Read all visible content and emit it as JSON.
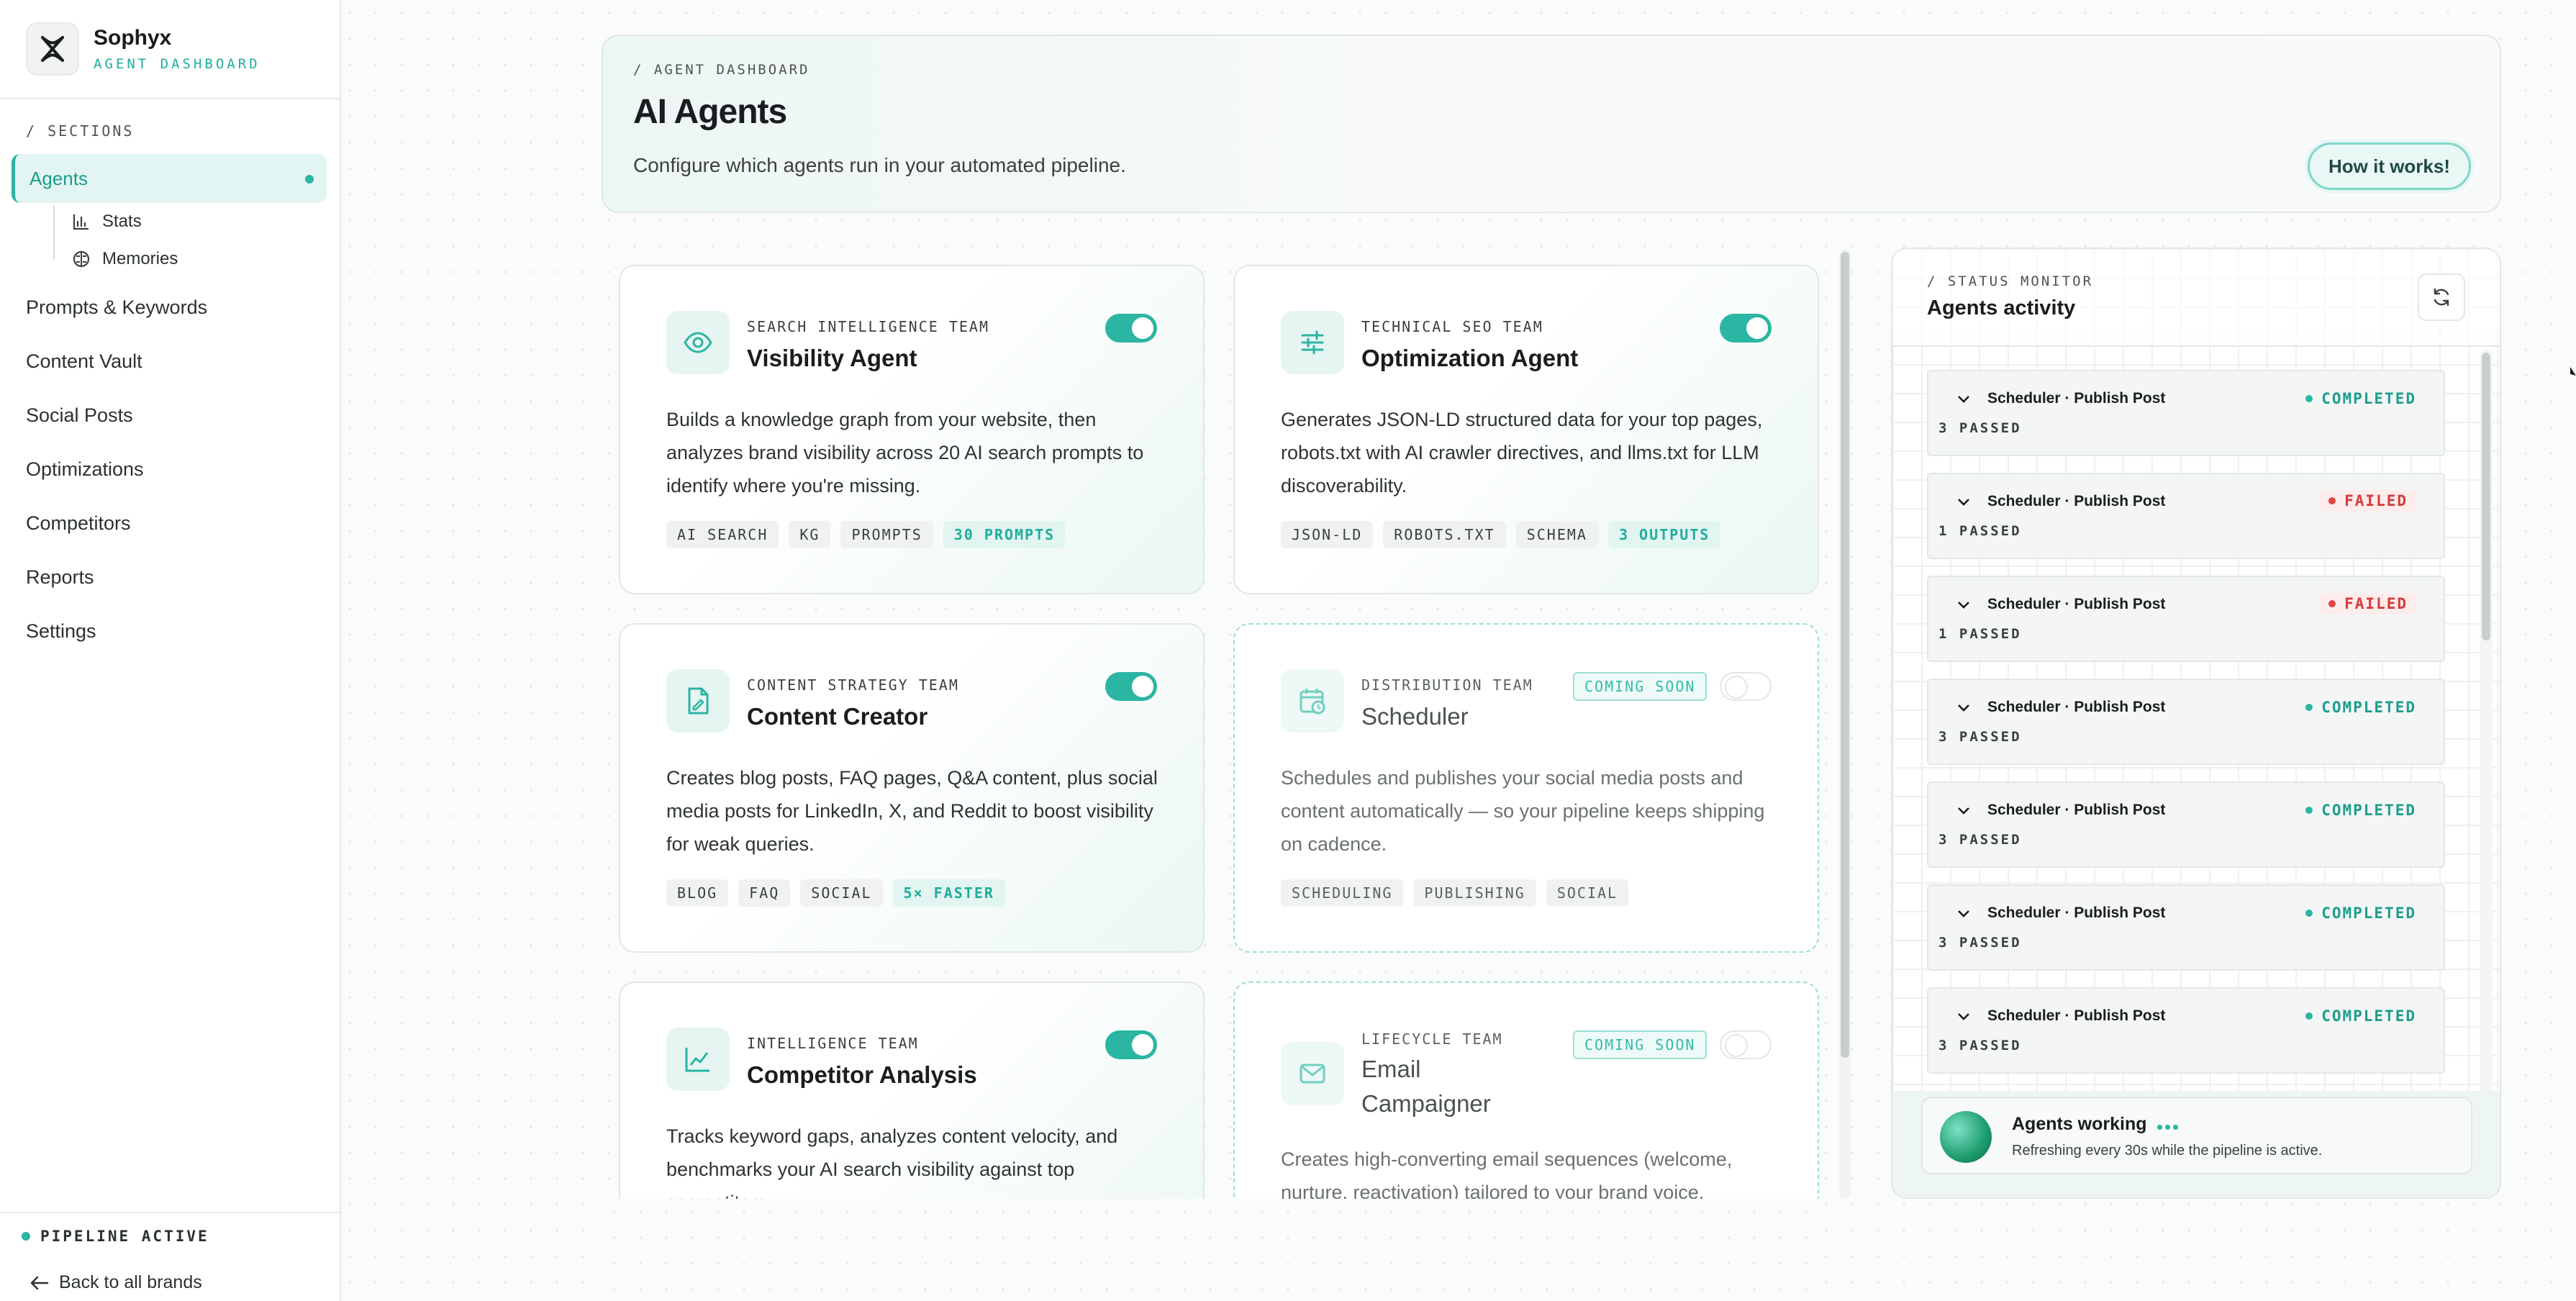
{
  "brand": {
    "name": "Sophyx",
    "subtitle": "AGENT DASHBOARD"
  },
  "sidebar": {
    "section_label": "/ SECTIONS",
    "active_item": "Agents",
    "sub_items": [
      {
        "label": "Stats",
        "icon": "bar-chart-icon"
      },
      {
        "label": "Memories",
        "icon": "brain-icon"
      }
    ],
    "items": [
      "Prompts & Keywords",
      "Content Vault",
      "Social Posts",
      "Optimizations",
      "Competitors",
      "Reports",
      "Settings"
    ],
    "footer_status": "PIPELINE ACTIVE",
    "back_link": "Back to all brands"
  },
  "header": {
    "breadcrumb": "/ AGENT DASHBOARD",
    "title": "AI Agents",
    "description": "Configure which agents run in your automated pipeline.",
    "how_button": "How it works!"
  },
  "agents": [
    {
      "team": "SEARCH INTELLIGENCE TEAM",
      "name": "Visibility Agent",
      "icon": "eye-icon",
      "enabled": true,
      "description": "Builds a knowledge graph from your website, then analyzes brand visibility across 20 AI search prompts to identify where you're missing.",
      "tags": [
        "AI SEARCH",
        "KG",
        "PROMPTS"
      ],
      "accent_tag": "30 PROMPTS"
    },
    {
      "team": "TECHNICAL SEO TEAM",
      "name": "Optimization Agent",
      "icon": "sliders-icon",
      "enabled": true,
      "description": "Generates JSON-LD structured data for your top pages, robots.txt with AI crawler directives, and llms.txt for LLM discoverability.",
      "tags": [
        "JSON-LD",
        "ROBOTS.TXT",
        "SCHEMA"
      ],
      "accent_tag": "3 OUTPUTS"
    },
    {
      "team": "CONTENT STRATEGY TEAM",
      "name": "Content Creator",
      "icon": "document-edit-icon",
      "enabled": true,
      "description": "Creates blog posts, FAQ pages, Q&A content, plus social media posts for LinkedIn, X, and Reddit to boost visibility for weak queries.",
      "tags": [
        "BLOG",
        "FAQ",
        "SOCIAL"
      ],
      "accent_tag": "5× FASTER"
    },
    {
      "team": "DISTRIBUTION TEAM",
      "name": "Scheduler",
      "icon": "calendar-clock-icon",
      "enabled": false,
      "badge": "COMING SOON",
      "description": "Schedules and publishes your social media posts and content automatically — so your pipeline keeps shipping on cadence.",
      "tags": [
        "SCHEDULING",
        "PUBLISHING",
        "SOCIAL"
      ]
    },
    {
      "team": "INTELLIGENCE TEAM",
      "name": "Competitor Analysis",
      "icon": "line-chart-icon",
      "enabled": true,
      "description": "Tracks keyword gaps, analyzes content velocity, and benchmarks your AI search visibility against top competitors."
    },
    {
      "team": "LIFECYCLE TEAM",
      "name": "Email Campaigner",
      "icon": "mail-icon",
      "enabled": false,
      "badge": "COMING SOON",
      "description": "Creates high-converting email sequences (welcome, nurture, reactivation) tailored to your brand voice."
    }
  ],
  "monitor": {
    "breadcrumb": "/ STATUS MONITOR",
    "title": "Agents activity",
    "runs": [
      {
        "title": "Scheduler · Publish Post",
        "passed": "3 PASSED",
        "status": "COMPLETED",
        "state": "ok"
      },
      {
        "title": "Scheduler · Publish Post",
        "passed": "1 PASSED",
        "status": "FAILED",
        "state": "fail"
      },
      {
        "title": "Scheduler · Publish Post",
        "passed": "1 PASSED",
        "status": "FAILED",
        "state": "fail"
      },
      {
        "title": "Scheduler · Publish Post",
        "passed": "3 PASSED",
        "status": "COMPLETED",
        "state": "ok"
      },
      {
        "title": "Scheduler · Publish Post",
        "passed": "3 PASSED",
        "status": "COMPLETED",
        "state": "ok"
      },
      {
        "title": "Scheduler · Publish Post",
        "passed": "3 PASSED",
        "status": "COMPLETED",
        "state": "ok"
      },
      {
        "title": "Scheduler · Publish Post",
        "passed": "3 PASSED",
        "status": "COMPLETED",
        "state": "ok"
      }
    ],
    "working_title": "Agents working",
    "working_sub": "Refreshing every 30s while the pipeline is active."
  },
  "colors": {
    "accent": "#2bb5a3",
    "accent_dark": "#1c9d8c",
    "fail": "#d43a3a"
  }
}
